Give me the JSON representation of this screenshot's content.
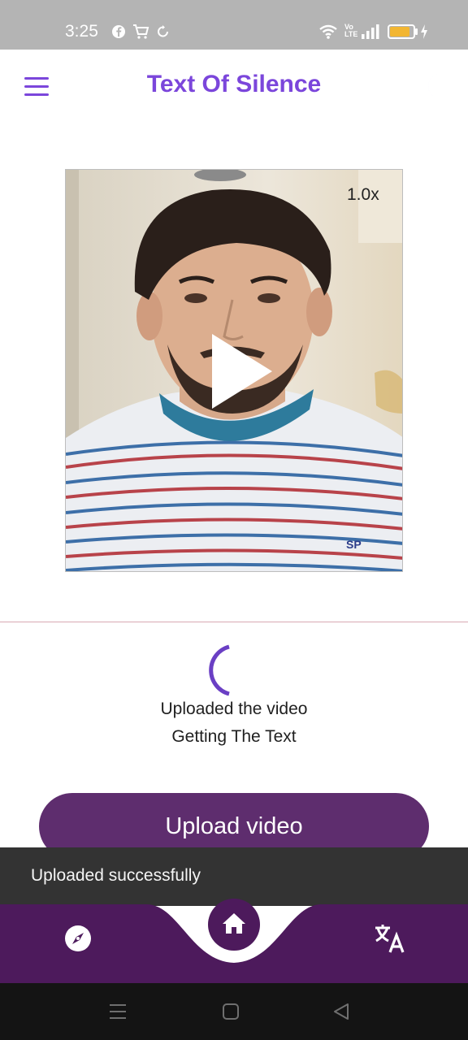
{
  "status_bar": {
    "time": "3:25",
    "left_icons": [
      "facebook-icon",
      "cart-icon",
      "sync-icon"
    ],
    "right_icons": [
      "wifi-icon",
      "volte-icon",
      "signal-icon",
      "battery-icon",
      "charging-icon"
    ],
    "volte_text": "Vo LTE",
    "battery_level": 0.85,
    "battery_color": "#f2b632"
  },
  "app_bar": {
    "title": "Text Of Silence",
    "menu_icon": "hamburger-menu-icon",
    "theme_icon": "moon-icon",
    "accent_color": "#7b46db"
  },
  "video": {
    "playback_speed": "1.0x",
    "play_icon": "play-icon",
    "shirt_logo": "SP"
  },
  "processing": {
    "line1": "Uploaded the video",
    "line2": "Getting The Text",
    "spinner_color": "#6a3fc4"
  },
  "upload_button": {
    "label": "Upload video",
    "color": "#5e2d6e"
  },
  "snackbar": {
    "message": "Uploaded successfully"
  },
  "bottom_nav": {
    "items": [
      {
        "name": "explore",
        "icon": "compass-icon"
      },
      {
        "name": "home",
        "icon": "home-icon",
        "selected": true
      },
      {
        "name": "translate",
        "icon": "translate-icon"
      }
    ],
    "color": "#4d1a5c"
  },
  "system_nav": {
    "buttons": [
      "recents-icon",
      "home-square-icon",
      "back-triangle-icon"
    ]
  }
}
